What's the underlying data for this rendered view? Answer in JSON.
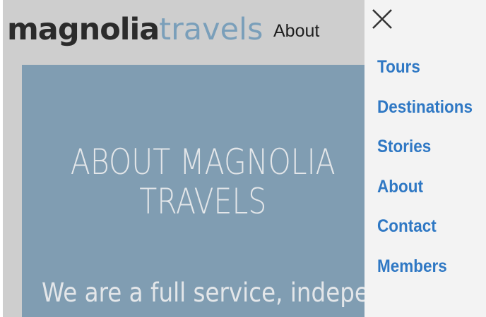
{
  "brand": {
    "logo_part1": "magnolia",
    "logo_part2": "travels"
  },
  "header": {
    "about_label": "About"
  },
  "hero": {
    "title": "ABOUT MAGNOLIA TRAVELS",
    "text": "We are a full service, independent"
  },
  "drawer": {
    "close_icon": "close-icon",
    "items": [
      {
        "label": "Tours"
      },
      {
        "label": "Destinations"
      },
      {
        "label": "Stories"
      },
      {
        "label": "About"
      },
      {
        "label": "Contact"
      },
      {
        "label": "Members"
      }
    ]
  },
  "colors": {
    "page_bg": "#cecece",
    "hero_bg": "#809db2",
    "drawer_bg": "#f3f3f3",
    "link": "#2f78c4",
    "logo_dark": "#2b2b2b",
    "logo_accent": "#7a9fba"
  }
}
